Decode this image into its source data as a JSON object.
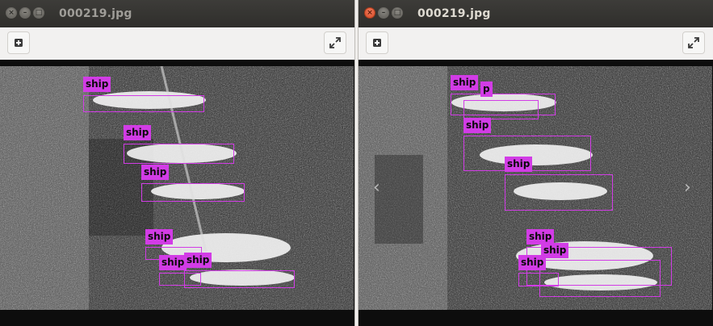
{
  "left_window": {
    "title": "000219.jpg",
    "label_text": "ship"
  },
  "right_window": {
    "title": "000219.jpg",
    "label_text": "ship",
    "occluded_label_text": "p",
    "nav_prev": "‹",
    "nav_next": "›"
  },
  "window_buttons": {
    "close": "×",
    "minimize": "–",
    "maximize": "□"
  },
  "toolbar": {
    "add_icon": "add-icon",
    "expand_icon": "expand-icon"
  },
  "colors": {
    "box": "#d23ce6",
    "titlebar": "#33322f"
  }
}
